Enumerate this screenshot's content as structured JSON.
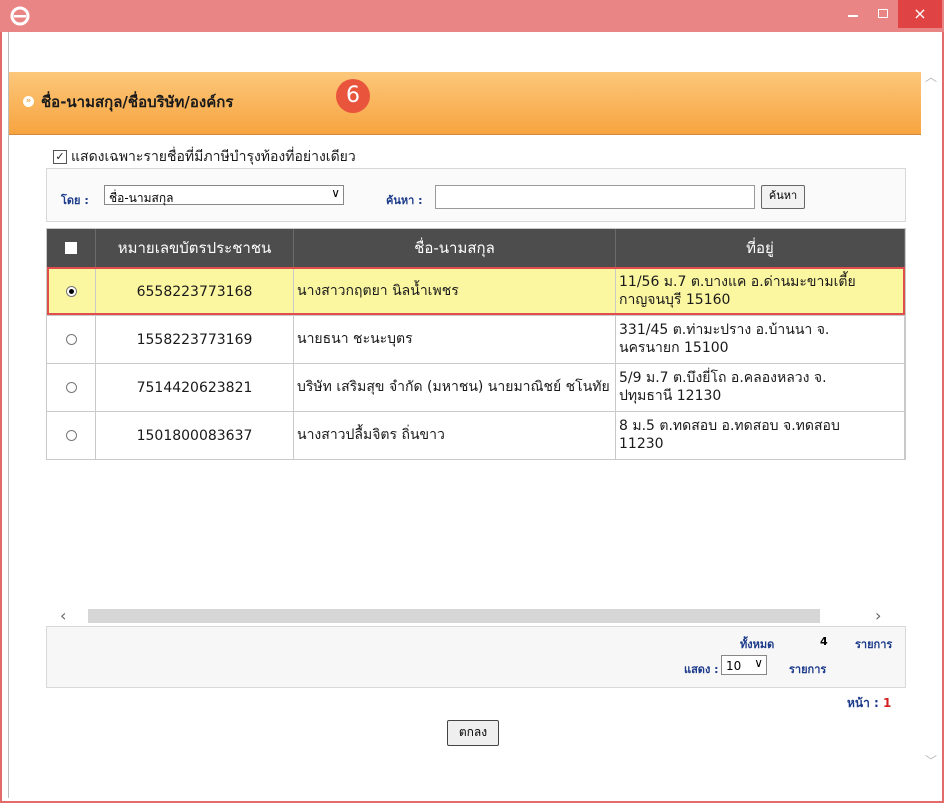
{
  "window": {
    "close_symbol": "×"
  },
  "header": {
    "title": "ชื่อ-นามสกุล/ชื่อบริษัท/องค์กร",
    "step_number": "6"
  },
  "filter": {
    "checked": true,
    "label": "แสดงเฉพาะรายชื่อที่มีภาษีบำรุงท้องที่อย่างเดียว"
  },
  "search": {
    "by_label": "โดย :",
    "by_value": "ชื่อ-นามสกุล",
    "search_label": "ค้นหา :",
    "search_value": "",
    "search_button": "ค้นหา"
  },
  "table": {
    "columns": [
      "หมายเลขบัตรประชาชน",
      "ชื่อ-นามสกุล",
      "ที่อยู่"
    ],
    "rows": [
      {
        "selected": true,
        "id": "6558223773168",
        "name": "นางสาวกฤตยา นิลน้ำเพชร",
        "address_line1": "11/56 ม.7 ต.บางแค อ.ด่านมะขามเตี้ย",
        "address_line2": "กาญจนบุรี 15160"
      },
      {
        "selected": false,
        "id": "1558223773169",
        "name": "นายธนา ชะนะบุตร",
        "address_line1": "331/45 ต.ท่ามะปราง อ.บ้านนา จ.",
        "address_line2": "นครนายก 15100"
      },
      {
        "selected": false,
        "id": "7514420623821",
        "name": "บริษัท เสริมสุข จำกัด (มหาชน) นายมาณิชย์ ชโนทัย",
        "address_line1": "5/9 ม.7 ต.บึงยี่โถ อ.คลองหลวง จ.",
        "address_line2": "ปทุมธานี 12130"
      },
      {
        "selected": false,
        "id": "1501800083637",
        "name": "นางสาวปลื้มจิตร ถิ่นขาว",
        "address_line1": "8 ม.5 ต.ทดสอบ อ.ทดสอบ จ.ทดสอบ",
        "address_line2": "11230"
      }
    ]
  },
  "footer": {
    "total_label": "ทั้งหมด",
    "total_count": "4",
    "total_unit": "รายการ",
    "show_label": "แสดง :",
    "page_size": "10",
    "show_unit": "รายการ",
    "page_label": "หน้า :",
    "page_number": "1"
  },
  "ok_button": "ตกลง",
  "colors": {
    "header_orange": "#f7a440",
    "selected_row": "#fbf6a0",
    "highlight_border": "#df4d4d",
    "titlebar": "#ea8585",
    "step_badge": "#e8543c"
  },
  "icons": [
    "ie-logo-icon",
    "minimize-icon",
    "maximize-icon",
    "close-icon",
    "chevron-down-icon",
    "radio-icon",
    "scroll-left-icon",
    "scroll-right-icon"
  ]
}
